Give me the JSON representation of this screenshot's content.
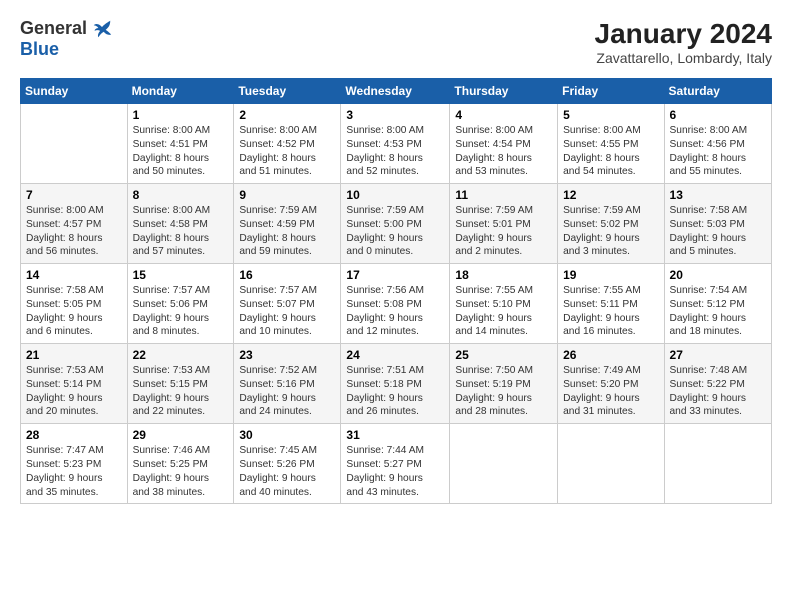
{
  "logo": {
    "general": "General",
    "blue": "Blue"
  },
  "title": "January 2024",
  "subtitle": "Zavattarello, Lombardy, Italy",
  "days_header": [
    "Sunday",
    "Monday",
    "Tuesday",
    "Wednesday",
    "Thursday",
    "Friday",
    "Saturday"
  ],
  "weeks": [
    [
      {
        "num": "",
        "info": ""
      },
      {
        "num": "1",
        "info": "Sunrise: 8:00 AM\nSunset: 4:51 PM\nDaylight: 8 hours\nand 50 minutes."
      },
      {
        "num": "2",
        "info": "Sunrise: 8:00 AM\nSunset: 4:52 PM\nDaylight: 8 hours\nand 51 minutes."
      },
      {
        "num": "3",
        "info": "Sunrise: 8:00 AM\nSunset: 4:53 PM\nDaylight: 8 hours\nand 52 minutes."
      },
      {
        "num": "4",
        "info": "Sunrise: 8:00 AM\nSunset: 4:54 PM\nDaylight: 8 hours\nand 53 minutes."
      },
      {
        "num": "5",
        "info": "Sunrise: 8:00 AM\nSunset: 4:55 PM\nDaylight: 8 hours\nand 54 minutes."
      },
      {
        "num": "6",
        "info": "Sunrise: 8:00 AM\nSunset: 4:56 PM\nDaylight: 8 hours\nand 55 minutes."
      }
    ],
    [
      {
        "num": "7",
        "info": "Sunrise: 8:00 AM\nSunset: 4:57 PM\nDaylight: 8 hours\nand 56 minutes."
      },
      {
        "num": "8",
        "info": "Sunrise: 8:00 AM\nSunset: 4:58 PM\nDaylight: 8 hours\nand 57 minutes."
      },
      {
        "num": "9",
        "info": "Sunrise: 7:59 AM\nSunset: 4:59 PM\nDaylight: 8 hours\nand 59 minutes."
      },
      {
        "num": "10",
        "info": "Sunrise: 7:59 AM\nSunset: 5:00 PM\nDaylight: 9 hours\nand 0 minutes."
      },
      {
        "num": "11",
        "info": "Sunrise: 7:59 AM\nSunset: 5:01 PM\nDaylight: 9 hours\nand 2 minutes."
      },
      {
        "num": "12",
        "info": "Sunrise: 7:59 AM\nSunset: 5:02 PM\nDaylight: 9 hours\nand 3 minutes."
      },
      {
        "num": "13",
        "info": "Sunrise: 7:58 AM\nSunset: 5:03 PM\nDaylight: 9 hours\nand 5 minutes."
      }
    ],
    [
      {
        "num": "14",
        "info": "Sunrise: 7:58 AM\nSunset: 5:05 PM\nDaylight: 9 hours\nand 6 minutes."
      },
      {
        "num": "15",
        "info": "Sunrise: 7:57 AM\nSunset: 5:06 PM\nDaylight: 9 hours\nand 8 minutes."
      },
      {
        "num": "16",
        "info": "Sunrise: 7:57 AM\nSunset: 5:07 PM\nDaylight: 9 hours\nand 10 minutes."
      },
      {
        "num": "17",
        "info": "Sunrise: 7:56 AM\nSunset: 5:08 PM\nDaylight: 9 hours\nand 12 minutes."
      },
      {
        "num": "18",
        "info": "Sunrise: 7:55 AM\nSunset: 5:10 PM\nDaylight: 9 hours\nand 14 minutes."
      },
      {
        "num": "19",
        "info": "Sunrise: 7:55 AM\nSunset: 5:11 PM\nDaylight: 9 hours\nand 16 minutes."
      },
      {
        "num": "20",
        "info": "Sunrise: 7:54 AM\nSunset: 5:12 PM\nDaylight: 9 hours\nand 18 minutes."
      }
    ],
    [
      {
        "num": "21",
        "info": "Sunrise: 7:53 AM\nSunset: 5:14 PM\nDaylight: 9 hours\nand 20 minutes."
      },
      {
        "num": "22",
        "info": "Sunrise: 7:53 AM\nSunset: 5:15 PM\nDaylight: 9 hours\nand 22 minutes."
      },
      {
        "num": "23",
        "info": "Sunrise: 7:52 AM\nSunset: 5:16 PM\nDaylight: 9 hours\nand 24 minutes."
      },
      {
        "num": "24",
        "info": "Sunrise: 7:51 AM\nSunset: 5:18 PM\nDaylight: 9 hours\nand 26 minutes."
      },
      {
        "num": "25",
        "info": "Sunrise: 7:50 AM\nSunset: 5:19 PM\nDaylight: 9 hours\nand 28 minutes."
      },
      {
        "num": "26",
        "info": "Sunrise: 7:49 AM\nSunset: 5:20 PM\nDaylight: 9 hours\nand 31 minutes."
      },
      {
        "num": "27",
        "info": "Sunrise: 7:48 AM\nSunset: 5:22 PM\nDaylight: 9 hours\nand 33 minutes."
      }
    ],
    [
      {
        "num": "28",
        "info": "Sunrise: 7:47 AM\nSunset: 5:23 PM\nDaylight: 9 hours\nand 35 minutes."
      },
      {
        "num": "29",
        "info": "Sunrise: 7:46 AM\nSunset: 5:25 PM\nDaylight: 9 hours\nand 38 minutes."
      },
      {
        "num": "30",
        "info": "Sunrise: 7:45 AM\nSunset: 5:26 PM\nDaylight: 9 hours\nand 40 minutes."
      },
      {
        "num": "31",
        "info": "Sunrise: 7:44 AM\nSunset: 5:27 PM\nDaylight: 9 hours\nand 43 minutes."
      },
      {
        "num": "",
        "info": ""
      },
      {
        "num": "",
        "info": ""
      },
      {
        "num": "",
        "info": ""
      }
    ]
  ]
}
